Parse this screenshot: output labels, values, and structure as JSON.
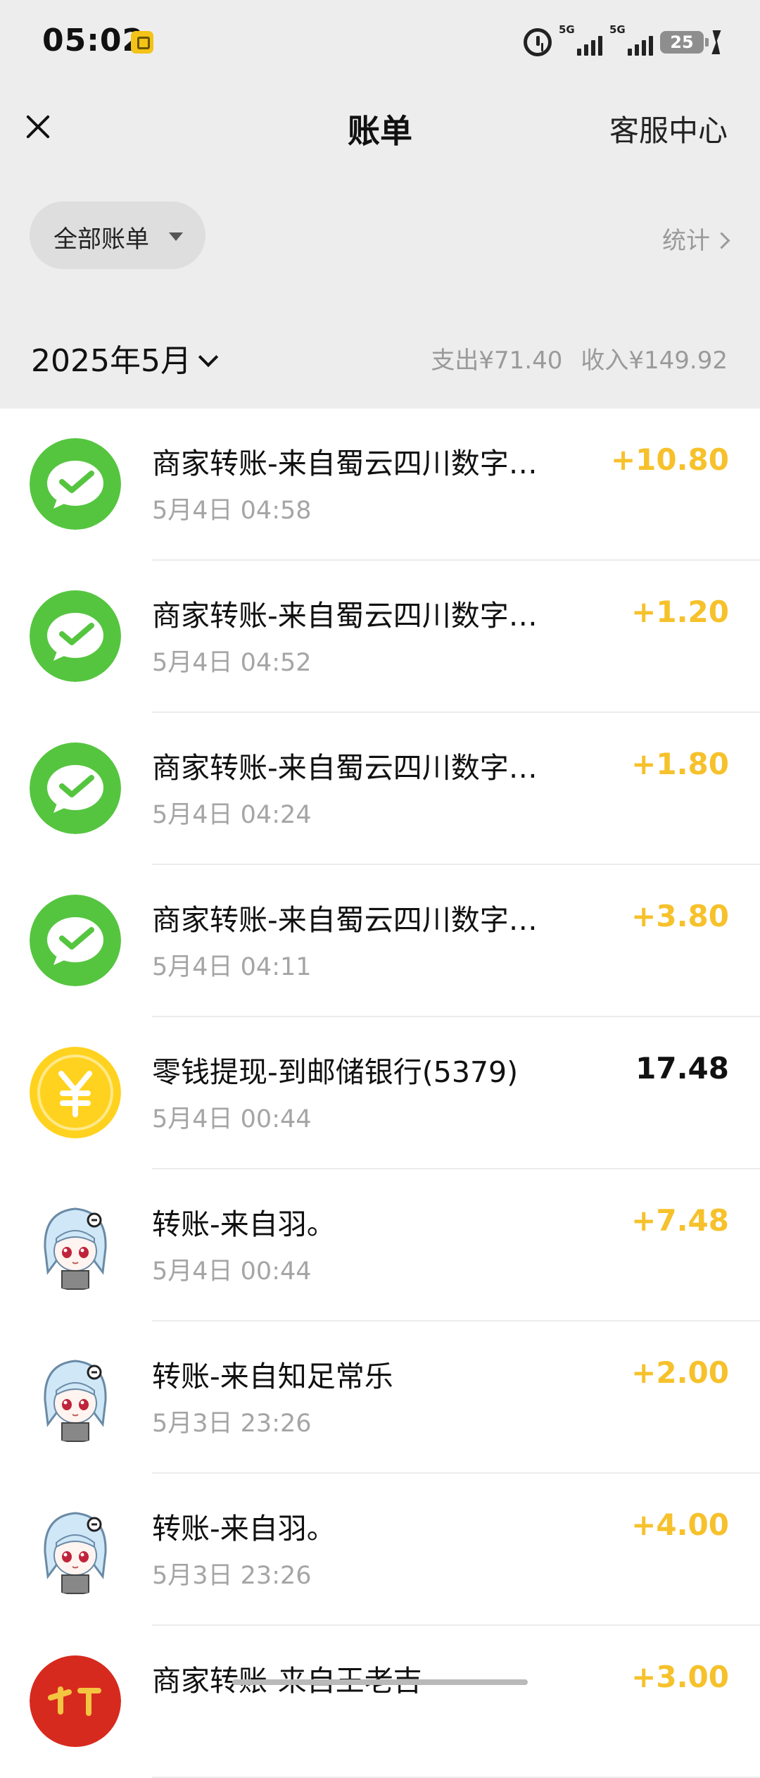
{
  "status_bar": {
    "time": "05:02",
    "net1": "5G",
    "net2": "5G",
    "battery": "25"
  },
  "header": {
    "title": "账单",
    "service_label": "客服中心"
  },
  "filter": {
    "label": "全部账单",
    "stats_label": "统计"
  },
  "month_bar": {
    "month": "2025年5月",
    "expense": "支出¥71.40",
    "income": "收入¥149.92"
  },
  "colors": {
    "income": "#f6c12b",
    "wechat_green": "#55c53f",
    "coin_yellow": "#ffd21f"
  },
  "transactions": [
    {
      "icon": "wechat-pay-icon",
      "title": "商家转账-来自蜀云四川数字…",
      "time": "5月4日 04:58",
      "amount": "+10.80"
    },
    {
      "icon": "wechat-pay-icon",
      "title": "商家转账-来自蜀云四川数字…",
      "time": "5月4日 04:52",
      "amount": "+1.20"
    },
    {
      "icon": "wechat-pay-icon",
      "title": "商家转账-来自蜀云四川数字…",
      "time": "5月4日 04:24",
      "amount": "+1.80"
    },
    {
      "icon": "wechat-pay-icon",
      "title": "商家转账-来自蜀云四川数字…",
      "time": "5月4日 04:11",
      "amount": "+3.80"
    },
    {
      "icon": "yuan-coin-icon",
      "title": "零钱提现-到邮储银行(5379)",
      "time": "5月4日 00:44",
      "amount": "17.48"
    },
    {
      "icon": "anime-avatar",
      "title": "转账-来自羽。",
      "time": "5月4日 00:44",
      "amount": "+7.48"
    },
    {
      "icon": "anime-avatar",
      "title": "转账-来自知足常乐",
      "time": "5月3日 23:26",
      "amount": "+2.00"
    },
    {
      "icon": "anime-avatar",
      "title": "转账-来自羽。",
      "time": "5月3日 23:26",
      "amount": "+4.00"
    },
    {
      "icon": "merchant-logo-icon",
      "title": "商家转账-来自王老吉",
      "time": "",
      "amount": "+3.00"
    }
  ]
}
